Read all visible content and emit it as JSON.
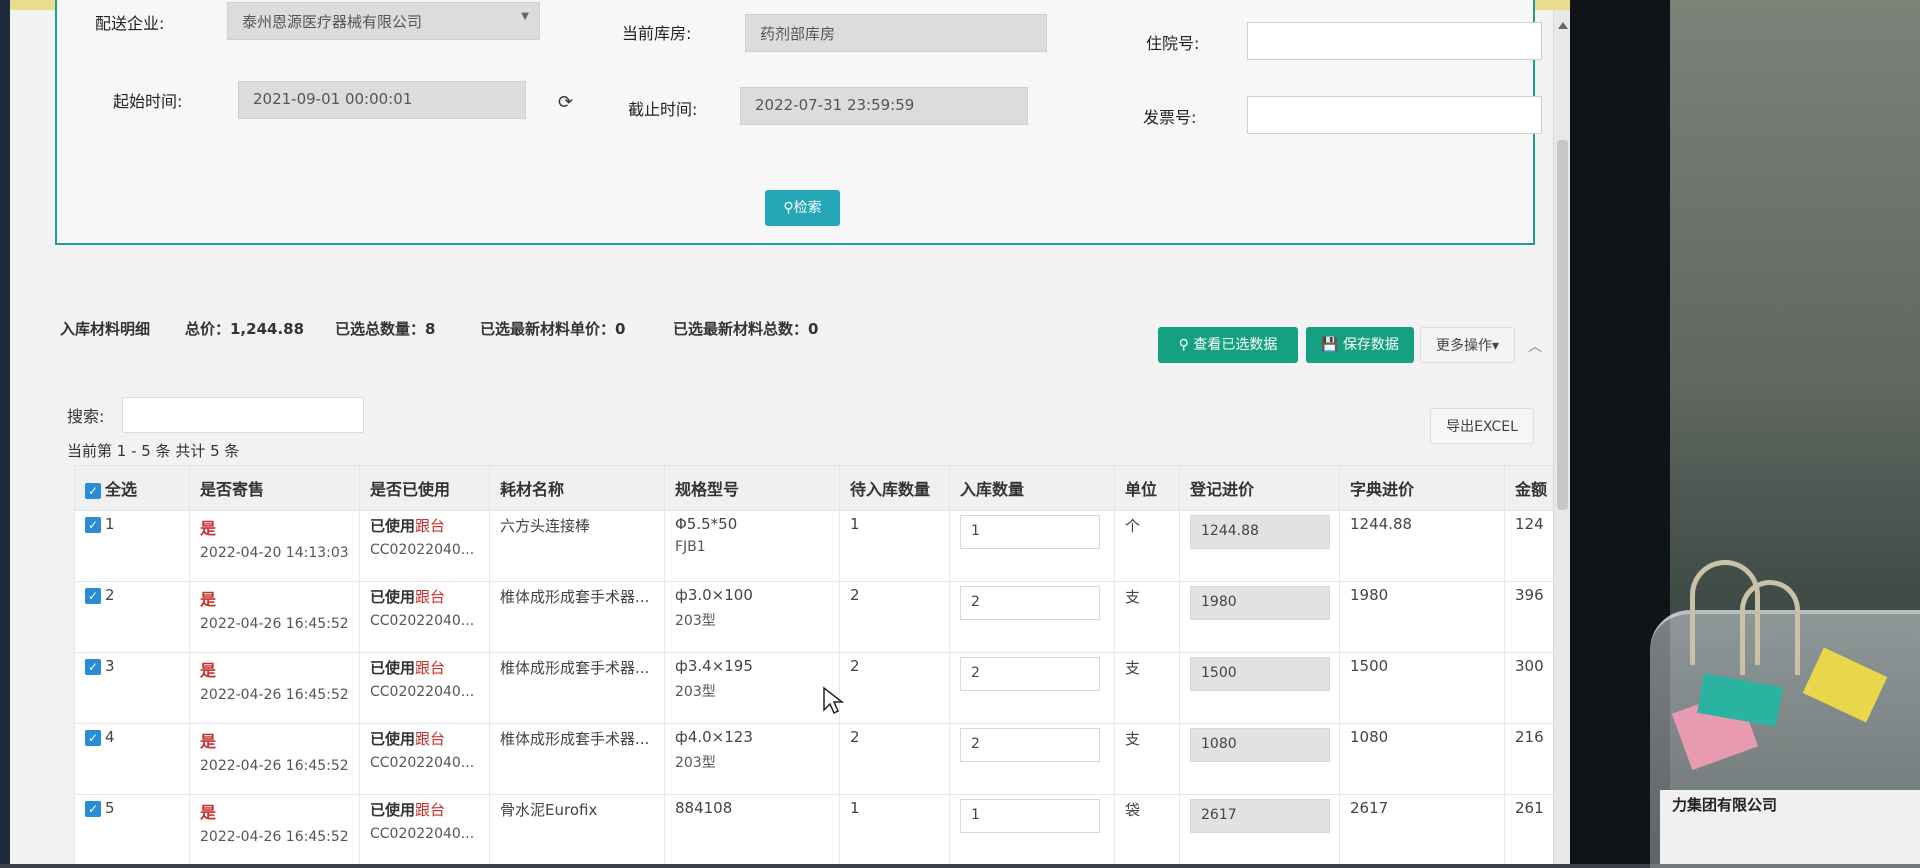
{
  "filters": {
    "delivery_company_label": "配送企业:",
    "delivery_company_value": "泰州恩源医疗器械有限公司",
    "current_warehouse_label": "当前库房:",
    "current_warehouse_value": "药剂部库房",
    "hospital_no_label": "住院号:",
    "hospital_no_value": "",
    "start_time_label": "起始时间:",
    "start_time_value": "2021-09-01 00:00:01",
    "end_time_label": "截止时间:",
    "end_time_value": "2022-07-31 23:59:59",
    "invoice_no_label": "发票号:",
    "invoice_no_value": "",
    "search_button": "检索"
  },
  "summary": {
    "title": "入库材料明细",
    "total_price": "总价：1,244.88",
    "selected_total_qty": "已选总数量：8",
    "selected_new_unit_price": "已选最新材料单价：0",
    "selected_new_total": "已选最新材料总数：0"
  },
  "actions": {
    "view_selected": "查看已选数据",
    "save_data": "保存数据",
    "more_ops": "更多操作",
    "export_excel": "导出EXCEL"
  },
  "search": {
    "label": "搜索:",
    "value": ""
  },
  "pager": {
    "text": "当前第 1 - 5 条   共计 5 条"
  },
  "table": {
    "headers": [
      "全选",
      "是否寄售",
      "是否已使用",
      "耗材名称",
      "规格型号",
      "待入库数量",
      "入库数量",
      "单位",
      "登记进价",
      "字典进价",
      "金额"
    ],
    "rows": [
      {
        "index": "1",
        "consign": "是",
        "consign_time": "2022-04-20 14:13:03",
        "used": "已使用",
        "follow": "跟台",
        "code": "CC02022040...",
        "name": "六方头连接棒",
        "spec_line1": "Φ5.5*50",
        "spec_line2": "FJB1",
        "pending_qty": "1",
        "in_qty": "1",
        "unit": "个",
        "reg_price": "1244.88",
        "dict_price": "1244.88",
        "amount": "124"
      },
      {
        "index": "2",
        "consign": "是",
        "consign_time": "2022-04-26 16:45:52",
        "used": "已使用",
        "follow": "跟台",
        "code": "CC02022040...",
        "name": "椎体成形成套手术器...",
        "spec_line1": "ф3.0×100",
        "spec_line2": "203型",
        "pending_qty": "2",
        "in_qty": "2",
        "unit": "支",
        "reg_price": "1980",
        "dict_price": "1980",
        "amount": "396"
      },
      {
        "index": "3",
        "consign": "是",
        "consign_time": "2022-04-26 16:45:52",
        "used": "已使用",
        "follow": "跟台",
        "code": "CC02022040...",
        "name": "椎体成形成套手术器...",
        "spec_line1": "ф3.4×195",
        "spec_line2": "203型",
        "pending_qty": "2",
        "in_qty": "2",
        "unit": "支",
        "reg_price": "1500",
        "dict_price": "1500",
        "amount": "300"
      },
      {
        "index": "4",
        "consign": "是",
        "consign_time": "2022-04-26 16:45:52",
        "used": "已使用",
        "follow": "跟台",
        "code": "CC02022040...",
        "name": "椎体成形成套手术器...",
        "spec_line1": "ф4.0×123",
        "spec_line2": "203型",
        "pending_qty": "2",
        "in_qty": "2",
        "unit": "支",
        "reg_price": "1080",
        "dict_price": "1080",
        "amount": "216"
      },
      {
        "index": "5",
        "consign": "是",
        "consign_time": "2022-04-26 16:45:52",
        "used": "已使用",
        "follow": "跟台",
        "code": "CC02022040...",
        "name": "骨水泥Eurofix",
        "spec_line1": "884108",
        "spec_line2": "",
        "pending_qty": "1",
        "in_qty": "1",
        "unit": "袋",
        "reg_price": "2617",
        "dict_price": "2617",
        "amount": "261"
      }
    ]
  },
  "background": {
    "jar_label_text": "力集团有限公司"
  },
  "colors": {
    "accent_teal": "#25a7b8",
    "button_green": "#15a081",
    "panel_border": "#1c9f8e",
    "consign_red": "#c9302c",
    "checkbox_blue": "#2a8bd6"
  }
}
